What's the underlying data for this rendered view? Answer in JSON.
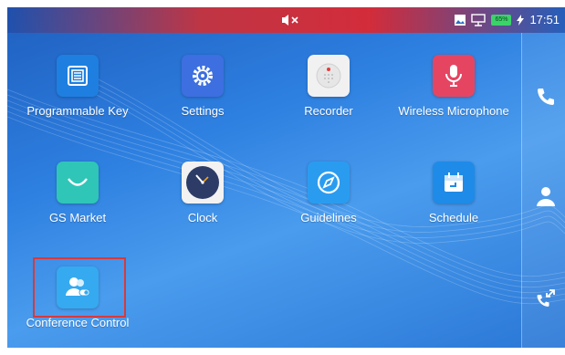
{
  "status_bar": {
    "time": "17:51",
    "battery_percent": "65%",
    "icons": [
      "mute-icon",
      "image-icon",
      "network-icon",
      "battery-icon",
      "charging-icon"
    ]
  },
  "apps": [
    {
      "label": "Programmable Key",
      "icon": "programmable-key-icon",
      "color": "#1e7fe0"
    },
    {
      "label": "Settings",
      "icon": "settings-gear-icon",
      "color": "#3d6fe0"
    },
    {
      "label": "Recorder",
      "icon": "recorder-icon",
      "color": "#f1f1f1"
    },
    {
      "label": "Wireless Microphone",
      "icon": "microphone-icon",
      "color": "#e64562"
    },
    {
      "label": "GS Market",
      "icon": "gs-market-icon",
      "color": "#2fc6b8"
    },
    {
      "label": "Clock",
      "icon": "clock-icon",
      "color": "#2d3c66"
    },
    {
      "label": "Guidelines",
      "icon": "compass-icon",
      "color": "#2a9cf0"
    },
    {
      "label": "Schedule",
      "icon": "calendar-icon",
      "color": "#1e8be8"
    },
    {
      "label": "Conference Control",
      "icon": "conference-control-icon",
      "color": "#35aaf0"
    }
  ],
  "sidebar": [
    "phone-icon",
    "contacts-icon",
    "call-history-icon"
  ],
  "highlight_color": "#d83a3a"
}
